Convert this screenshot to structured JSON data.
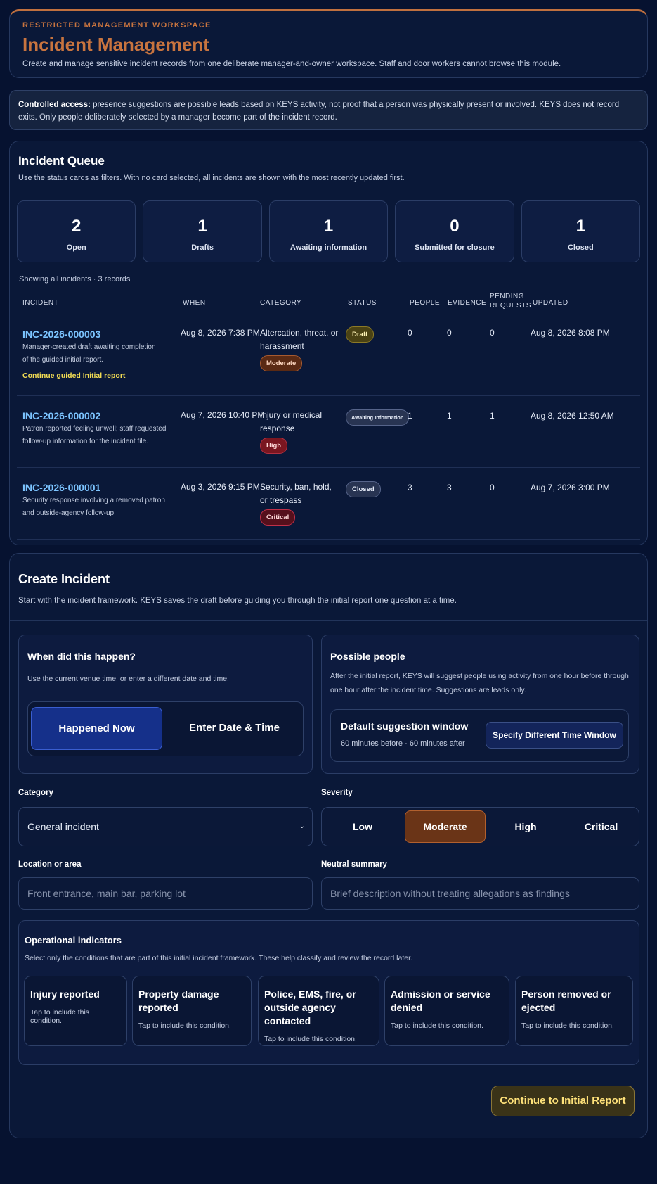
{
  "header": {
    "eyebrow": "RESTRICTED MANAGEMENT WORKSPACE",
    "title": "Incident Management",
    "subtitle": "Create and manage sensitive incident records from one deliberate manager-and-owner workspace. Staff and door workers cannot browse this module."
  },
  "notice": {
    "label": "Controlled access:",
    "text": "presence suggestions are possible leads based on KEYS activity, not proof that a person was physically present or involved. KEYS does not record exits. Only people deliberately selected by a manager become part of the incident record."
  },
  "queue": {
    "title": "Incident Queue",
    "subtitle": "Use the status cards as filters. With no card selected, all incidents are shown with the most recently updated first.",
    "cards": [
      {
        "count": "2",
        "label": "Open"
      },
      {
        "count": "1",
        "label": "Drafts"
      },
      {
        "count": "1",
        "label": "Awaiting information"
      },
      {
        "count": "0",
        "label": "Submitted for closure"
      },
      {
        "count": "1",
        "label": "Closed"
      }
    ],
    "showing": "Showing all incidents · 3 records",
    "columns": {
      "incident": "INCIDENT",
      "when": "WHEN",
      "category": "CATEGORY",
      "status": "STATUS",
      "people": "PEOPLE",
      "evidence": "EVIDENCE",
      "pending": "PENDING",
      "requests": "REQUESTS",
      "updated": "UPDATED"
    },
    "rows": [
      {
        "id": "INC-2026-000003",
        "desc": "Manager-created draft awaiting completion of the guided initial report.",
        "link": "Continue guided Initial report",
        "when": "Aug 8, 2026 7:38 PM",
        "category": "Altercation, threat, or harassment",
        "severity": "Moderate",
        "status": "Draft",
        "people": "0",
        "evidence": "0",
        "pending": "0",
        "updated": "Aug 8, 2026 8:08 PM"
      },
      {
        "id": "INC-2026-000002",
        "desc": "Patron reported feeling unwell; staff requested follow-up information for the incident file.",
        "when": "Aug 7, 2026 10:40 PM",
        "category": "Injury or medical response",
        "severity": "High",
        "status": "Awaiting Information",
        "people": "1",
        "evidence": "1",
        "pending": "1",
        "updated": "Aug 8, 2026 12:50 AM"
      },
      {
        "id": "INC-2026-000001",
        "desc": "Security response involving a removed patron and outside-agency follow-up.",
        "when": "Aug 3, 2026 9:15 PM",
        "category": "Security, ban, hold, or trespass",
        "severity": "Critical",
        "status": "Closed",
        "people": "3",
        "evidence": "3",
        "pending": "0",
        "updated": "Aug 7, 2026 3:00 PM"
      }
    ]
  },
  "create": {
    "title": "Create Incident",
    "subtitle": "Start with the incident framework. KEYS saves the draft before guiding you through the initial report one question at a time.",
    "when": {
      "title": "When did this happen?",
      "subtitle": "Use the current venue time, or enter a different date and time.",
      "now_label": "Happened Now",
      "enter_label": "Enter Date & Time"
    },
    "people": {
      "title": "Possible people",
      "subtitle": "After the initial report, KEYS will suggest people using activity from one hour before through one hour after the incident time. Suggestions are leads only.",
      "window_title": "Default suggestion window",
      "window_detail": "60 minutes before · 60 minutes after",
      "window_button": "Specify Different Time Window"
    },
    "category": {
      "label": "Category",
      "value": "General incident"
    },
    "severity": {
      "label": "Severity",
      "options": [
        "Low",
        "Moderate",
        "High",
        "Critical"
      ],
      "selected": "Moderate"
    },
    "location": {
      "label": "Location or area",
      "placeholder": "Front entrance, main bar, parking lot"
    },
    "summary": {
      "label": "Neutral summary",
      "placeholder": "Brief description without treating allegations as findings"
    },
    "indicators": {
      "title": "Operational indicators",
      "subtitle": "Select only the conditions that are part of this initial incident framework. These help classify and review the record later.",
      "items": [
        {
          "title": "Injury reported",
          "hint": "Tap to include this condition."
        },
        {
          "title": "Property damage reported",
          "hint": "Tap to include this condition."
        },
        {
          "title": "Police, EMS, fire, or outside agency contacted",
          "hint": "Tap to include this condition."
        },
        {
          "title": "Admission or service denied",
          "hint": "Tap to include this condition."
        },
        {
          "title": "Person removed or ejected",
          "hint": "Tap to include this condition."
        }
      ]
    },
    "continue_label": "Continue to Initial Report"
  }
}
